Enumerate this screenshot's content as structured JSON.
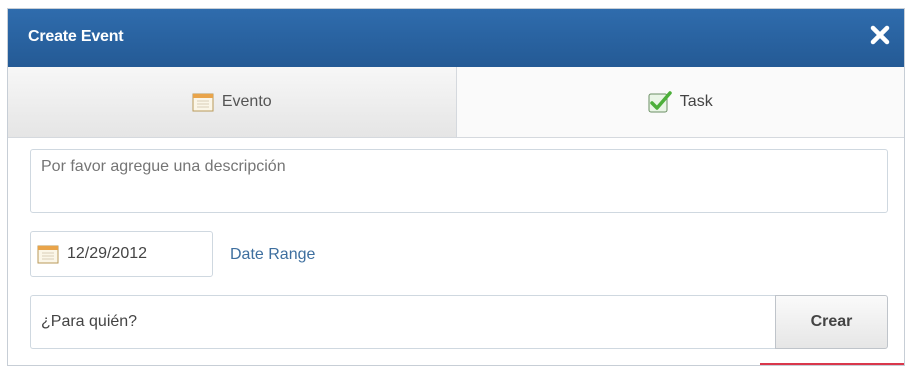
{
  "dialog": {
    "title": "Create Event",
    "close_icon": "close-x-icon"
  },
  "tabs": [
    {
      "label": "Evento",
      "icon": "calendar-icon",
      "active": true
    },
    {
      "label": "Task",
      "icon": "checkbox-checked-icon",
      "active": false
    }
  ],
  "form": {
    "description_placeholder": "Por favor agregue una descripción",
    "date_value": "12/29/2012",
    "date_icon": "calendar-icon",
    "date_range_label": "Date Range",
    "who_placeholder": "¿Para quién?",
    "submit_label": "Crear"
  },
  "colors": {
    "titlebar": "#2f6cad",
    "link": "#3e6f9f",
    "accent_red": "#d9374b",
    "check_green": "#4caf3a"
  }
}
